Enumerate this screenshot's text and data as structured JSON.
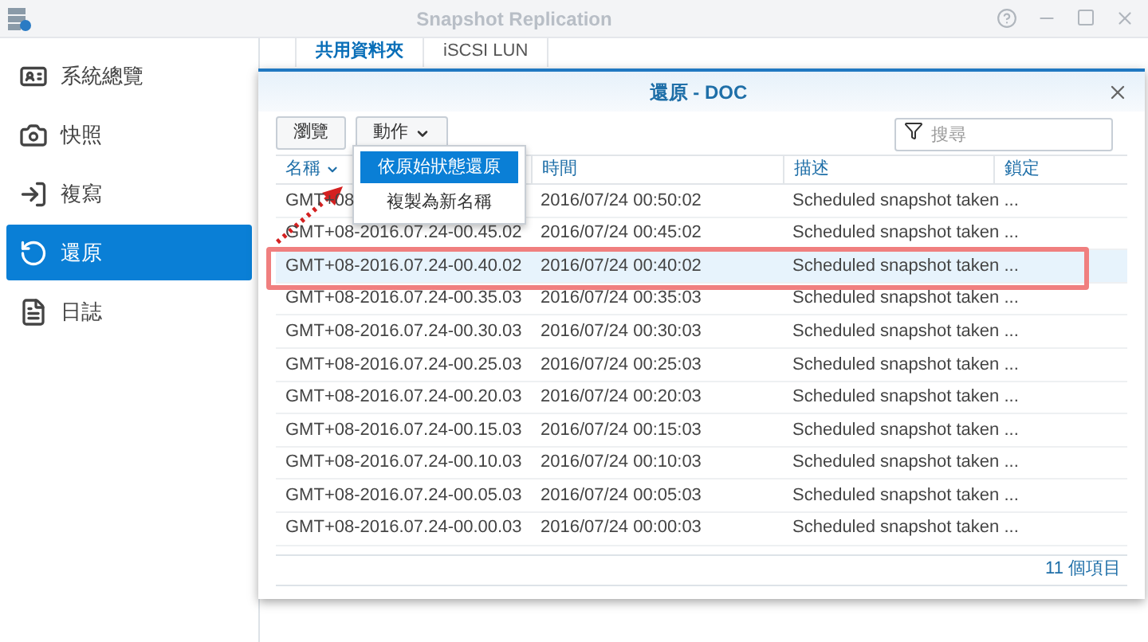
{
  "window": {
    "title": "Snapshot Replication"
  },
  "sidebar": {
    "items": [
      {
        "label": "系統總覽",
        "kind": "overview",
        "selected": false
      },
      {
        "label": "快照",
        "kind": "snapshot",
        "selected": false
      },
      {
        "label": "複寫",
        "kind": "replication",
        "selected": false
      },
      {
        "label": "還原",
        "kind": "restore",
        "selected": true
      },
      {
        "label": "日誌",
        "kind": "log",
        "selected": false
      }
    ]
  },
  "tabs": [
    {
      "label": "共用資料夾",
      "selected": true
    },
    {
      "label": "iSCSI LUN",
      "selected": false
    }
  ],
  "dialog": {
    "title": "還原 - DOC",
    "buttons": [
      {
        "label": "瀏覽",
        "kind": "plain"
      },
      {
        "label": "動作",
        "kind": "dropdown"
      }
    ],
    "search": {
      "placeholder": "搜尋"
    },
    "menu": [
      {
        "label": "依原始狀態還原",
        "selected": true
      },
      {
        "label": "複製為新名稱",
        "selected": false
      }
    ],
    "table": {
      "columns": [
        "名稱",
        "時間",
        "描述",
        "鎖定"
      ],
      "rows": [
        {
          "name": "GMT+08",
          "time": "2016/07/24 00:50:02",
          "description": "Scheduled snapshot taken ...",
          "selected": false
        },
        {
          "name": "GMT+08-2016.07.24-00.45.02",
          "time": "2016/07/24 00:45:02",
          "description": "Scheduled snapshot taken ...",
          "selected": false
        },
        {
          "name": "GMT+08-2016.07.24-00.40.02",
          "time": "2016/07/24 00:40:02",
          "description": "Scheduled snapshot taken ...",
          "selected": true
        },
        {
          "name": "GMT+08-2016.07.24-00.35.03",
          "time": "2016/07/24 00:35:03",
          "description": "Scheduled snapshot taken ...",
          "selected": false
        },
        {
          "name": "GMT+08-2016.07.24-00.30.03",
          "time": "2016/07/24 00:30:03",
          "description": "Scheduled snapshot taken ...",
          "selected": false
        },
        {
          "name": "GMT+08-2016.07.24-00.25.03",
          "time": "2016/07/24 00:25:03",
          "description": "Scheduled snapshot taken ...",
          "selected": false
        },
        {
          "name": "GMT+08-2016.07.24-00.20.03",
          "time": "2016/07/24 00:20:03",
          "description": "Scheduled snapshot taken ...",
          "selected": false
        },
        {
          "name": "GMT+08-2016.07.24-00.15.03",
          "time": "2016/07/24 00:15:03",
          "description": "Scheduled snapshot taken ...",
          "selected": false
        },
        {
          "name": "GMT+08-2016.07.24-00.10.03",
          "time": "2016/07/24 00:10:03",
          "description": "Scheduled snapshot taken ...",
          "selected": false
        },
        {
          "name": "GMT+08-2016.07.24-00.05.03",
          "time": "2016/07/24 00:05:03",
          "description": "Scheduled snapshot taken ...",
          "selected": false
        },
        {
          "name": "GMT+08-2016.07.24-00.00.03",
          "time": "2016/07/24 00:00:03",
          "description": "Scheduled snapshot taken ...",
          "selected": false
        }
      ]
    },
    "footer": "11 個項目"
  }
}
